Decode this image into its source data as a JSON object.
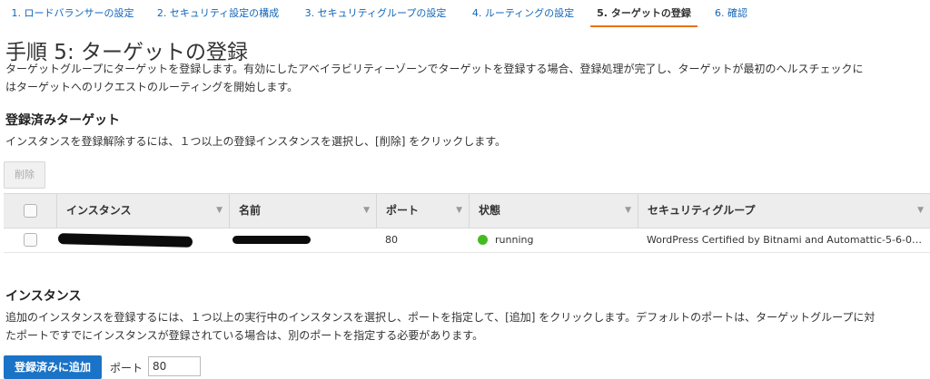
{
  "wizard": {
    "steps": [
      {
        "label": "1. ロードバランサーの設定"
      },
      {
        "label": "2. セキュリティ設定の構成"
      },
      {
        "label": "3. セキュリティグループの設定"
      },
      {
        "label": "4. ルーティングの設定"
      },
      {
        "label": "5. ターゲットの登録"
      },
      {
        "label": "6. 確認"
      }
    ],
    "active_step": 5
  },
  "page": {
    "title": "手順 5: ターゲットの登録",
    "description_line1": "ターゲットグループにターゲットを登録します。有効にしたアベイラビリティーゾーンでターゲットを登録する場合、登録処理が完了し、ターゲットが最初のヘルスチェックに",
    "description_line2": "はターゲットへのリクエストのルーティングを開始します。"
  },
  "registered": {
    "heading": "登録済みターゲット",
    "instructions": "インスタンスを登録解除するには、１つ以上の登録インスタンスを選択し、[削除] をクリックします。",
    "remove_label": "削除",
    "columns": [
      "インスタンス",
      "名前",
      "ポート",
      "状態",
      "セキュリティグループ"
    ],
    "rows": [
      {
        "instance": "",
        "name": "",
        "port": "80",
        "state": "running",
        "security_group": "WordPress Certified by Bitnami and Automattic-5-6-0…"
      }
    ]
  },
  "instances": {
    "heading": "インスタンス",
    "instructions_line1": "追加のインスタンスを登録するには、１つ以上の実行中のインスタンスを選択し、ポートを指定して、[追加] をクリックします。デフォルトのポートは、ターゲットグループに対",
    "instructions_line2": "たポートですでにインスタンスが登録されている場合は、別のポートを指定する必要があります。",
    "add_button_label": "登録済みに追加",
    "port_label": "ポート",
    "port_value": "80"
  },
  "colors": {
    "accent": "#ec7211",
    "link": "#1166bb",
    "primary_button": "#1a73c7",
    "status_running": "#44bb22"
  }
}
